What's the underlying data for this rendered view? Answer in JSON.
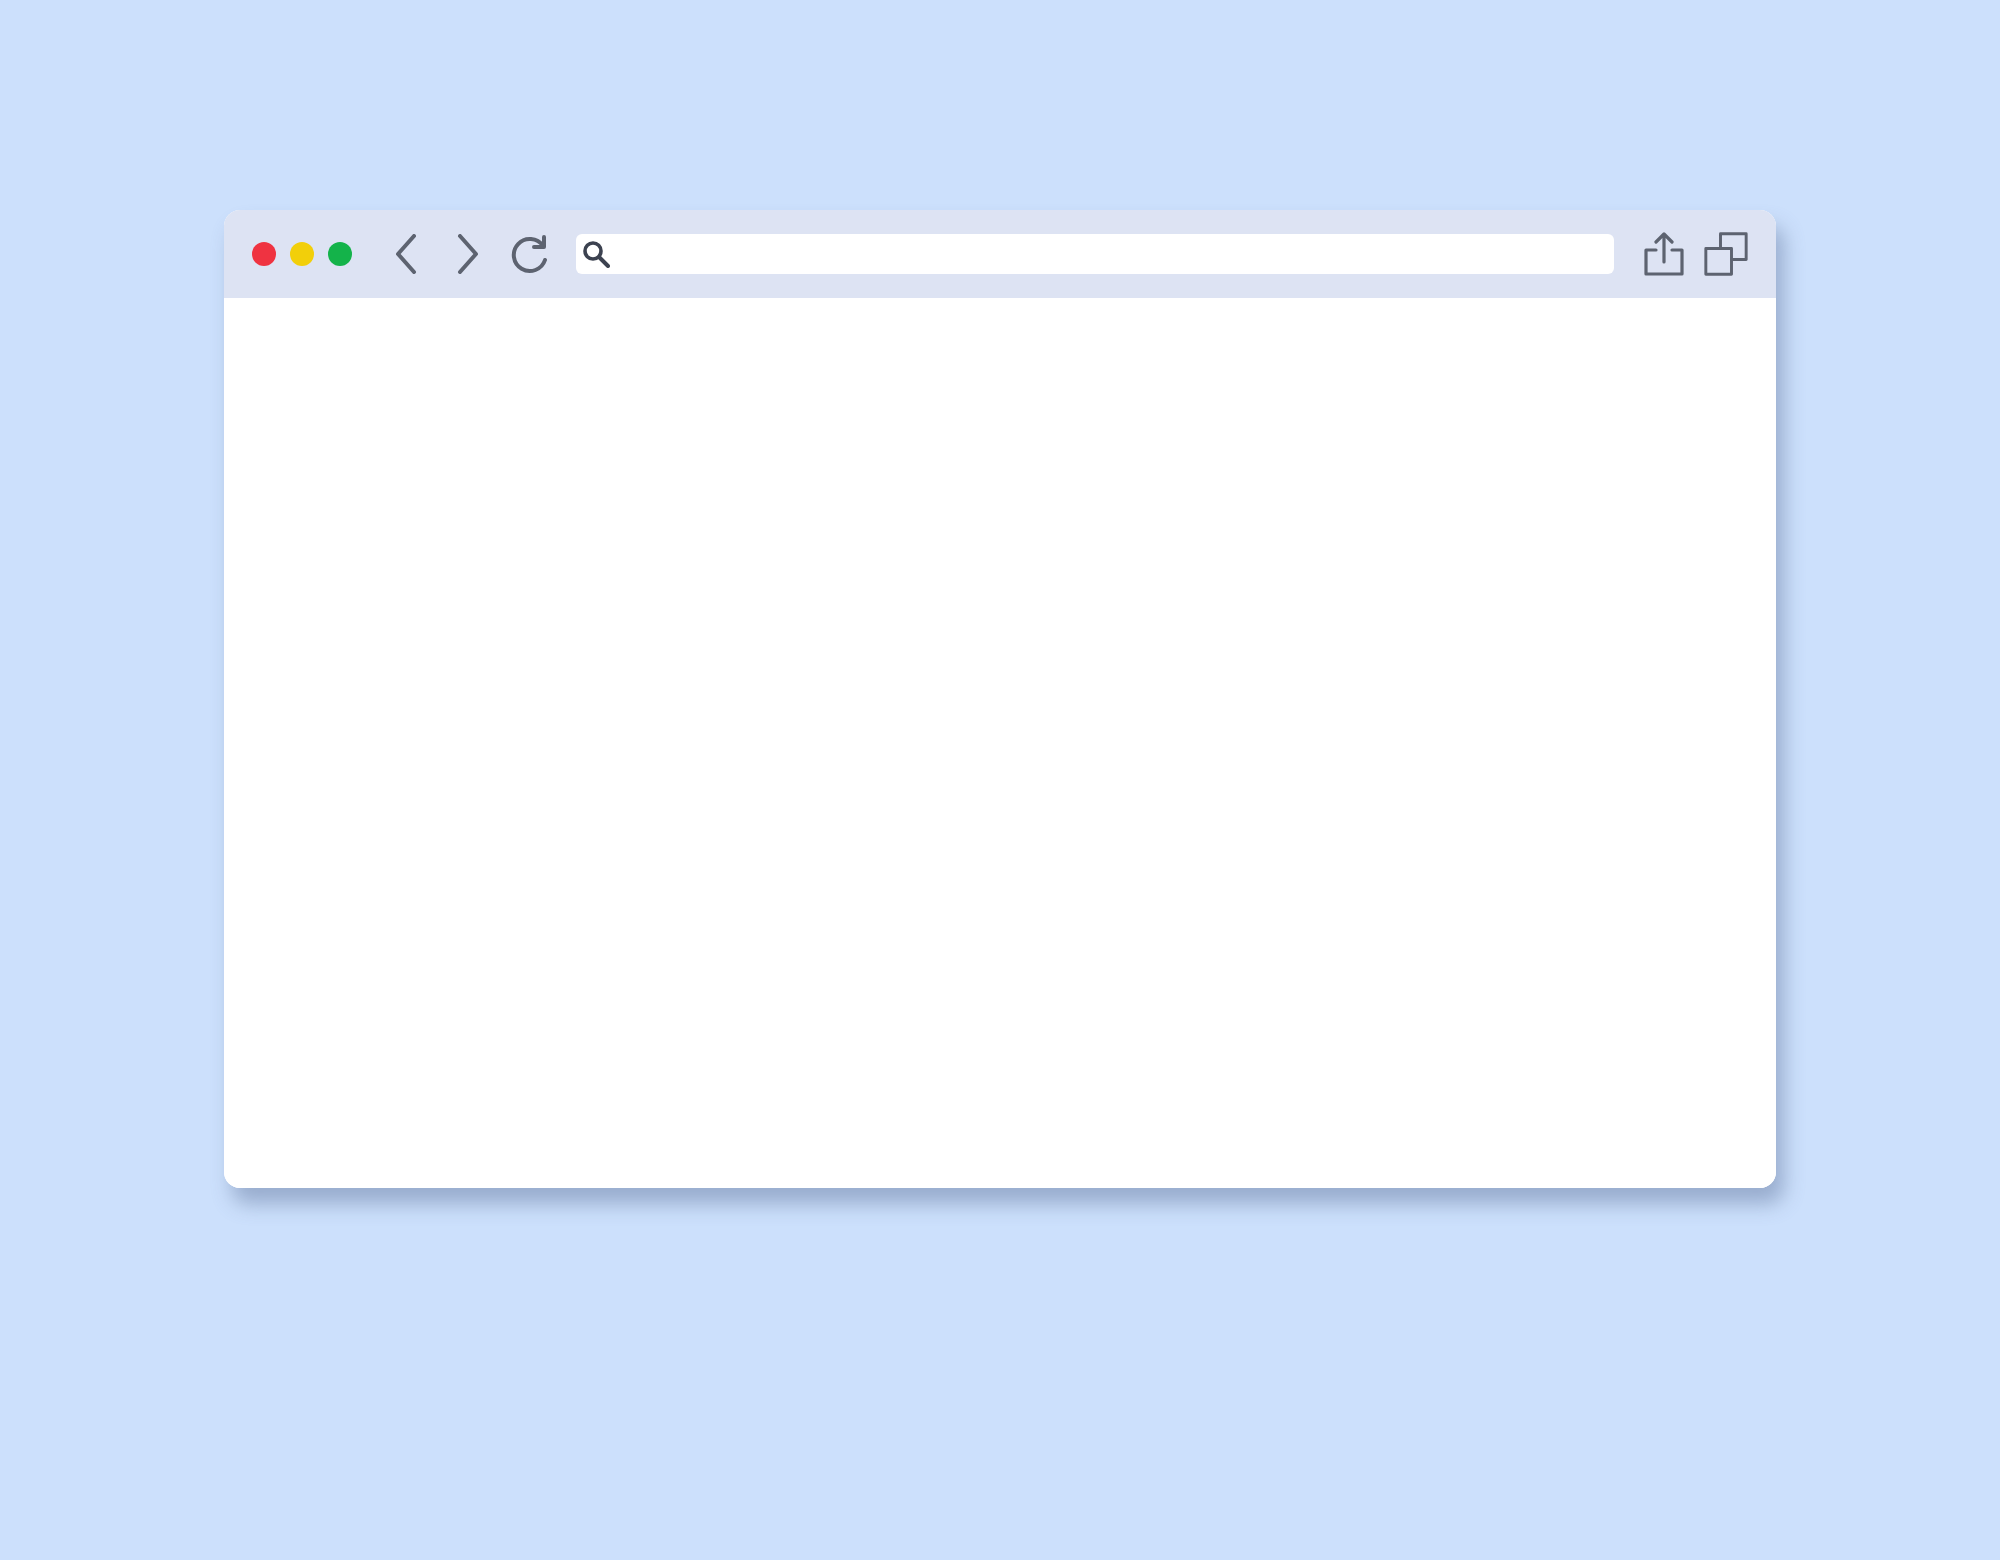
{
  "window": {
    "controls": [
      {
        "color": "#ef3341"
      },
      {
        "color": "#f2cf0a"
      },
      {
        "color": "#14b34a"
      }
    ],
    "toolbar_left": [
      {
        "kind": "back"
      },
      {
        "kind": "forward"
      },
      {
        "kind": "reload"
      }
    ],
    "address_bar": {
      "kind": "search"
    },
    "toolbar_right": [
      {
        "kind": "share"
      },
      {
        "kind": "windows"
      }
    ]
  }
}
